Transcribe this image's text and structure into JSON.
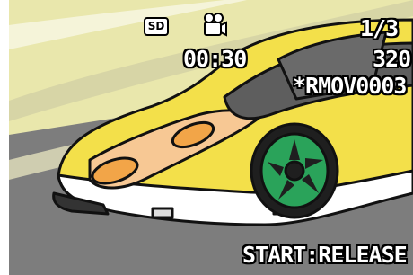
{
  "osd": {
    "media": "SD",
    "mode_icon": "movie-camera-icon",
    "frame_counter": "1/3",
    "recording_time": "00:30",
    "resolution": "320",
    "filename": "*RMOV0003",
    "start_hint": "START:RELEASE"
  },
  "colors": {
    "car_body": "#f3e04a",
    "stripe": "#f7c894",
    "wheel": "#2aa35a",
    "road": "#7d7d7d",
    "background": "#e8e6a8"
  }
}
